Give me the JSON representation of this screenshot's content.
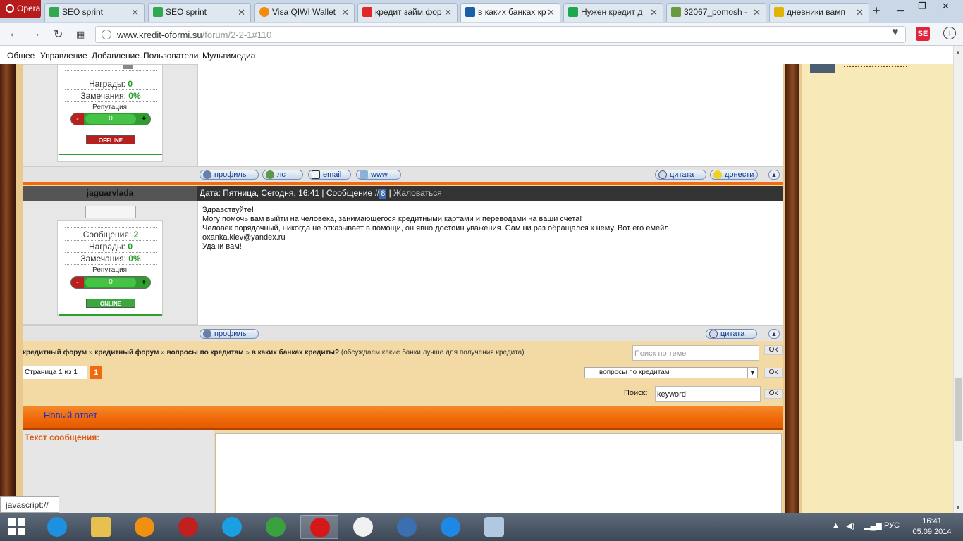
{
  "browser": {
    "menu_label": "Opera",
    "tabs": [
      {
        "label": "SEO sprint",
        "icon": "seosprint-icon",
        "color": "#2fa84f"
      },
      {
        "label": "SEO sprint",
        "icon": "seosprint-icon",
        "color": "#2fa84f"
      },
      {
        "label": "Visa QIWI Wallet",
        "icon": "qiwi-icon",
        "color": "#f28c0f"
      },
      {
        "label": "кредит займ фор",
        "icon": "yandex-icon",
        "color": "#e02828"
      },
      {
        "label": "в каких банках кр",
        "icon": "dollar-icon",
        "color": "#1b5fa8"
      },
      {
        "label": "Нужен кредит д",
        "icon": "dollar-icon",
        "color": "#1ba84f"
      },
      {
        "label": "32067_pomosh -",
        "icon": "image-icon",
        "color": "#6a9a40"
      },
      {
        "label": "дневники вамп",
        "icon": "video-icon",
        "color": "#e0b400"
      }
    ],
    "url_domain": "www.kredit-oformi.su",
    "url_path": "/forum/2-2-1#110",
    "bookmarks": [
      "Общее",
      "Управление",
      "Добавление",
      "Пользователи",
      "Мультимедиа"
    ],
    "status_text": "javascript://"
  },
  "post1": {
    "stats": {
      "awards_label": "Награды:",
      "awards": "0",
      "warnings_label": "Замечания:",
      "warnings": "0%"
    },
    "rep_label": "Репутация:",
    "rep_minus": "-",
    "rep_value": "0",
    "rep_plus": "+",
    "status": "OFFLINE",
    "actions": {
      "profile": "профиль",
      "pm": "лс",
      "email": "email",
      "www": "www",
      "quote": "цитата",
      "report": "донести"
    }
  },
  "post2": {
    "username": "jaguarvlada",
    "header": "Дата: Пятница, Сегодня, 16:41 | Сообщение #",
    "msg_num": "8",
    "complain_sep": "|",
    "complain": "Жаловаться",
    "stats": {
      "messages_label": "Сообщения:",
      "messages": "2",
      "awards_label": "Награды:",
      "awards": "0",
      "warnings_label": "Замечания:",
      "warnings": "0%"
    },
    "rep_label": "Репутация:",
    "rep_minus": "-",
    "rep_value": "0",
    "rep_plus": "+",
    "status": "ONLINE",
    "text_lines": [
      "Здравствуйте!",
      "Могу помочь вам выйти на человека, занимающегося кредитными картами и переводами на ваши счета!",
      "Человек порядочный, никогда не отказывает в помощи, он явно достоин уважения. Сам ни раз обращался к нему. Вот его емейл",
      "oxanka.kiev@yandex.ru",
      "Удачи вам!"
    ],
    "actions": {
      "profile": "профиль",
      "quote": "цитата"
    }
  },
  "forum": {
    "breadcrumb": [
      "кредитный форум",
      "кредитный форум",
      "вопросы по кредитам",
      "в каких банках кредиты?"
    ],
    "breadcrumb_sep": "»",
    "breadcrumb_desc": "(обсуждаем какие банки лучше для получения кредита)",
    "topic_search_placeholder": "Поиск по теме",
    "ok": "Ok",
    "pager_text": "Страница 1 из 1",
    "page_current": "1",
    "jump_select": "вопросы по кредитам",
    "search_label": "Поиск:",
    "search_value": "keyword"
  },
  "reply": {
    "title": "Новый ответ",
    "text_label": "Текст сообщения:"
  },
  "taskbar": {
    "lang": "РУС",
    "time": "16:41",
    "date": "05.09.2014"
  },
  "colors": {
    "accent_orange": "#f26a0f",
    "online": "#2e9f2e",
    "offline": "#b82020"
  }
}
